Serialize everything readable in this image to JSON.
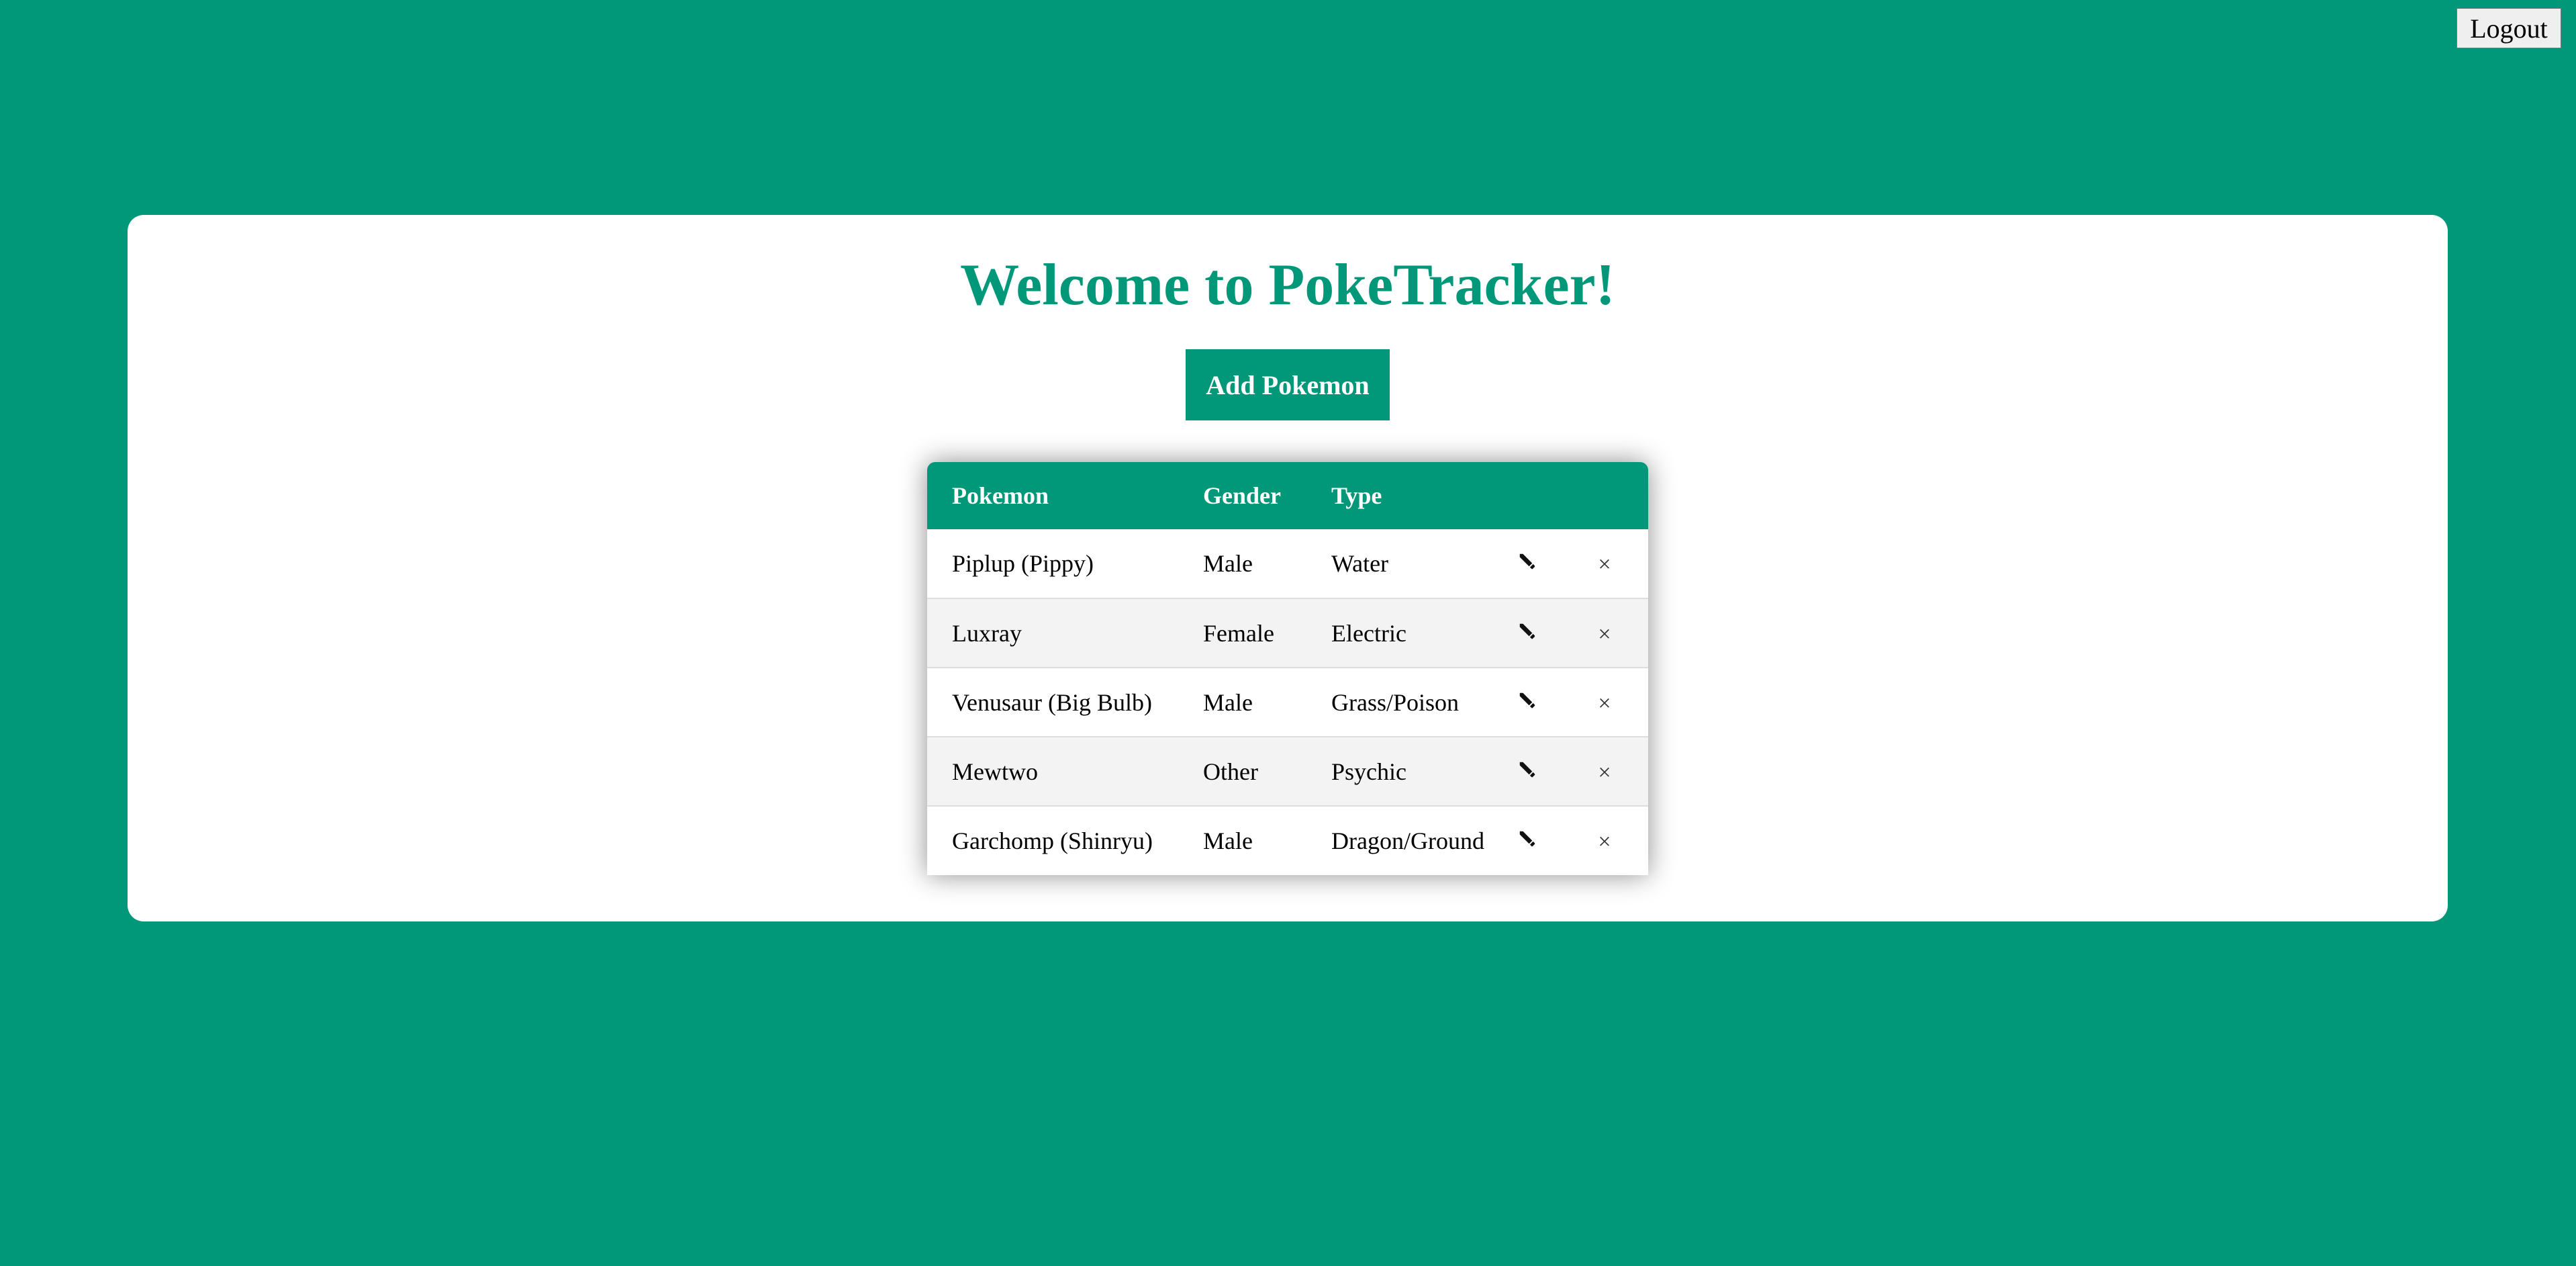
{
  "header": {
    "logout_label": "Logout"
  },
  "main": {
    "title": "Welcome to PokeTracker!",
    "add_button_label": "Add Pokemon"
  },
  "table": {
    "columns": [
      "Pokemon",
      "Gender",
      "Type"
    ],
    "rows": [
      {
        "pokemon": "Piplup (Pippy)",
        "gender": "Male",
        "type": "Water"
      },
      {
        "pokemon": "Luxray",
        "gender": "Female",
        "type": "Electric"
      },
      {
        "pokemon": "Venusaur (Big Bulb)",
        "gender": "Male",
        "type": "Grass/Poison"
      },
      {
        "pokemon": "Mewtwo",
        "gender": "Other",
        "type": "Psychic"
      },
      {
        "pokemon": "Garchomp (Shinryu)",
        "gender": "Male",
        "type": "Dragon/Ground"
      }
    ],
    "edit_icon": "pencil-icon",
    "delete_icon": "close-icon"
  },
  "colors": {
    "brand": "#009879",
    "card": "#ffffff",
    "row_alt": "#f3f3f3"
  }
}
